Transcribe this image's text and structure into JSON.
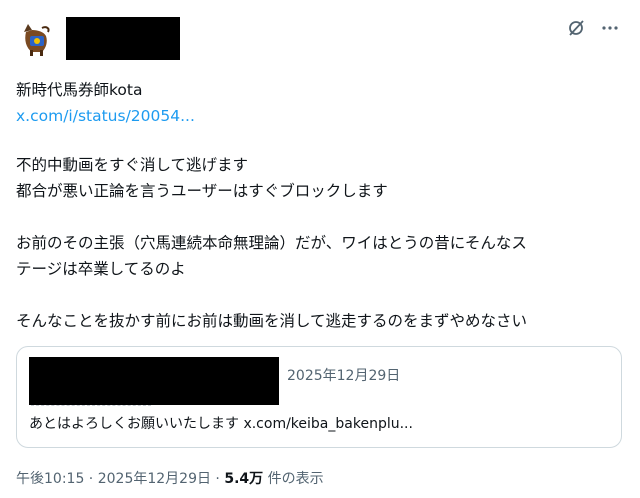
{
  "author": {
    "name": "新時代馬券師kota"
  },
  "tweet": {
    "link_text": "x.com/i/status/20054...",
    "line1": "不的中動画をすぐ消して逃げます",
    "line2": "都合が悪い正論を言うユーザーはすぐブロックします",
    "line3": "お前のその主張（穴馬連続本命無理論）だが、ワイはとうの昔にそんなス",
    "line4": "テージは卒業してるのよ",
    "line5": "そんなことを抜かす前にお前は動画を消して逃走するのをまずやめなさい"
  },
  "quote": {
    "date": "2025年12月29日",
    "text": "あとはよろしくお願いいたします x.com/keiba_bakenplu..."
  },
  "meta": {
    "time": "午後10:15",
    "sep1": " · ",
    "date": "2025年12月29日",
    "sep2": " · ",
    "views": "5.4万",
    "views_label": " 件の表示"
  },
  "icons": [
    "grok-icon",
    "more-icon"
  ]
}
